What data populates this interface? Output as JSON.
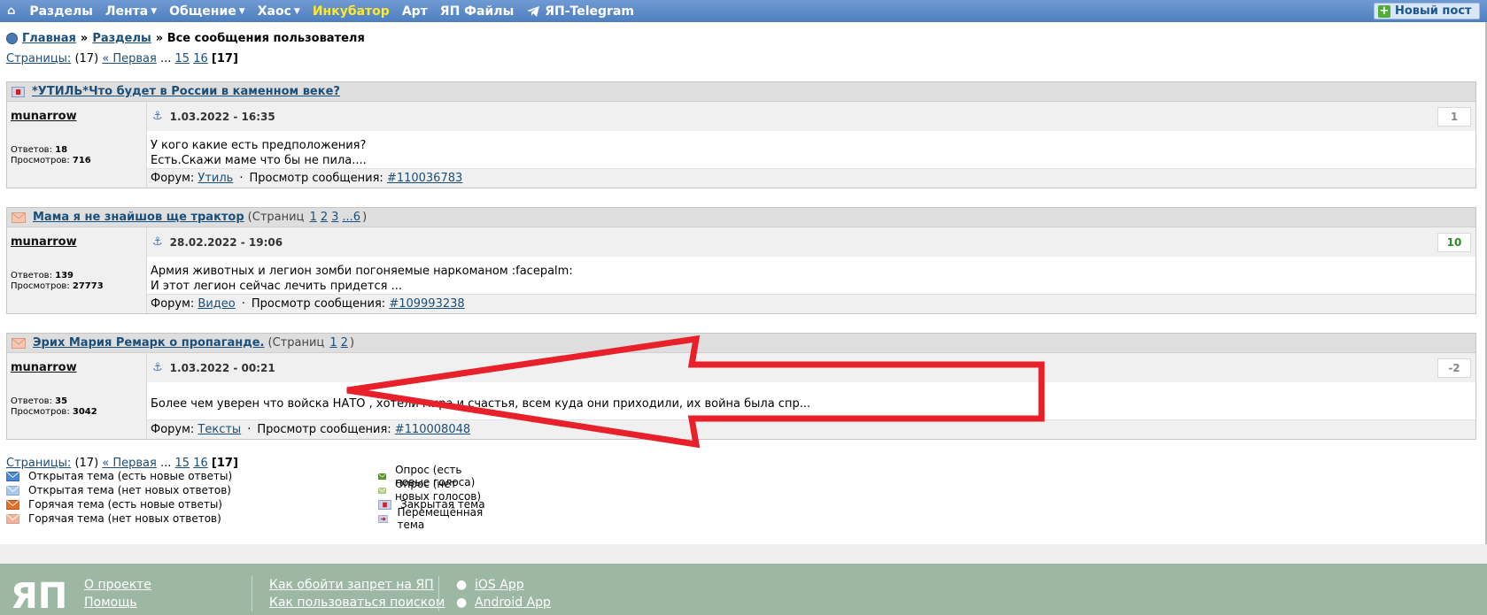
{
  "nav": {
    "home_icon": "home-icon",
    "items": [
      {
        "label": "Разделы",
        "caret": false
      },
      {
        "label": "Лента",
        "caret": true
      },
      {
        "label": "Общение",
        "caret": true
      },
      {
        "label": "Хаос",
        "caret": true
      },
      {
        "label": "Инкубатор",
        "caret": false,
        "accent": true
      },
      {
        "label": "Арт",
        "caret": false
      },
      {
        "label": "ЯП Файлы",
        "caret": false
      },
      {
        "label": "ЯП-Telegram",
        "caret": false
      }
    ],
    "new_post": "Новый пост"
  },
  "breadcrumb": {
    "home": "Главная",
    "sep": "»",
    "sections": "Разделы",
    "current": "» Все сообщения пользователя"
  },
  "pages": {
    "label": "Страницы:",
    "count": "(17)",
    "first": "« Первая",
    "ellipsis": "...",
    "p15": "15",
    "p16": "16",
    "current": "[17]"
  },
  "topics": [
    {
      "title": "*УТИЛЬ*Что будет в России в каменном веке?",
      "pages_prefix": "",
      "pages": [],
      "pages_suffix": "",
      "icon": "closed",
      "author": "munarrow",
      "answers_label": "Ответов:",
      "answers": "18",
      "views_label": "Просмотров:",
      "views": "716",
      "date": "1.03.2022 - 16:35",
      "rating": "1",
      "text1": "У кого какие есть предположения?",
      "text2": "Есть.Скажи маме что бы не пила....",
      "forum_label": "Форум:",
      "forum": "Утиль",
      "view_label": "Просмотр сообщения:",
      "post_id": "#110036783"
    },
    {
      "title": "Мама я не знайшов ще трактор",
      "pages_prefix": "(Страниц",
      "pages": [
        "1",
        "2",
        "3",
        "...6"
      ],
      "pages_suffix": ")",
      "icon": "hot-no-new",
      "author": "munarrow",
      "answers_label": "Ответов:",
      "answers": "139",
      "views_label": "Просмотров:",
      "views": "27773",
      "date": "28.02.2022 - 19:06",
      "rating": "10",
      "text1": "Армия животных и легион зомби погоняемые наркоманом :facepalm:",
      "text2": "И этот легион сейчас лечить придется ...",
      "forum_label": "Форум:",
      "forum": "Видео",
      "view_label": "Просмотр сообщения:",
      "post_id": "#109993238"
    },
    {
      "title": "Эрих Мария Ремарк о пропаганде.",
      "pages_prefix": "(Страниц",
      "pages": [
        "1",
        "2"
      ],
      "pages_suffix": ")",
      "icon": "hot-no-new",
      "author": "munarrow",
      "answers_label": "Ответов:",
      "answers": "35",
      "views_label": "Просмотров:",
      "views": "3042",
      "date": "1.03.2022 - 00:21",
      "rating": "-2",
      "text1": "Более чем уверен что войска НАТО , хотели мира и счастья, всем куда они приходили, их война была спр...",
      "text2": "",
      "forum_label": "Форум:",
      "forum": "Тексты",
      "view_label": "Просмотр сообщения:",
      "post_id": "#110008048"
    }
  ],
  "legend": {
    "col1": [
      {
        "label": "Открытая тема (есть новые ответы)",
        "color": "#4a88d0"
      },
      {
        "label": "Открытая тема (нет новых ответов)",
        "color": "#a9c8ea"
      },
      {
        "label": "Горячая тема (есть новые ответы)",
        "color": "#e0702a"
      },
      {
        "label": "Горячая тема (нет новых ответов)",
        "color": "#f0b49a"
      }
    ],
    "col2": [
      {
        "label": "Опрос (есть новые голоса)",
        "color": "#5a9e2a"
      },
      {
        "label": "Опрос (нет новых голосов)",
        "color": "#b4d890"
      },
      {
        "label": "Закрытая тема",
        "color": "#c9d4ea"
      },
      {
        "label": "Перемещённая тема",
        "color": "#c9d4ea"
      }
    ]
  },
  "footer": {
    "logo": "ЯП",
    "about": "О проекте",
    "help": "Помощь",
    "bypass": "Как обойти запрет на ЯП",
    "search_help": "Как пользоваться поиском",
    "ios": "iOS App",
    "android": "Android App"
  },
  "annotation_color": "#e8202a"
}
